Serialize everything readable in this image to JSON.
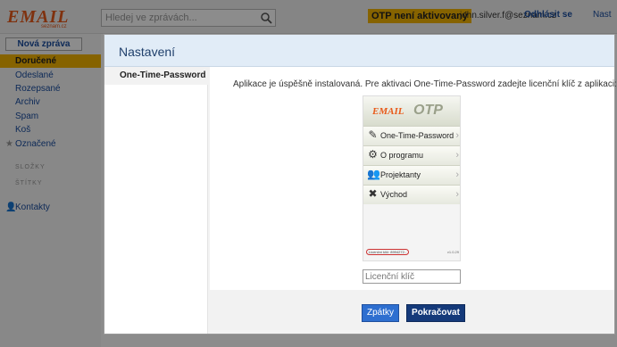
{
  "app": {
    "logo_text": "EMAIL",
    "logo_subtext": "seznam.cz",
    "search": {
      "placeholder": "Hledej ve zprávách...",
      "icon": "search-icon"
    },
    "otp_badge": "OTP není aktivovaný",
    "user_email": "john.silver.f@seznam.cz",
    "logout_label": "Odhlásit se",
    "settings_label": "Nast",
    "accent_color": "#f5b400",
    "link_color": "#1a4ea0"
  },
  "sidebar": {
    "compose_label": "Nová zpráva",
    "folders": [
      {
        "label": "Doručené",
        "active": true
      },
      {
        "label": "Odeslané",
        "active": false
      },
      {
        "label": "Rozepsané",
        "active": false
      },
      {
        "label": "Archiv",
        "active": false
      },
      {
        "label": "Spam",
        "active": false
      },
      {
        "label": "Koš",
        "active": false
      },
      {
        "label": "Označené",
        "active": false,
        "icon": "star-icon"
      }
    ],
    "sections": [
      "SLOŽKY",
      "ŠTÍTKY"
    ],
    "contacts_label": "Kontakty"
  },
  "dialog": {
    "title": "Nastavení",
    "nav": [
      {
        "label": "One-Time-Password",
        "active": true
      }
    ],
    "instruction": "Aplikace je úspěšně instalovaná. Pre aktivaci One-Time-Password zadejte licenční klíč z aplikaci:",
    "phone": {
      "logo_text": "EMAIL",
      "title": "OTP",
      "menu": [
        {
          "label": "One-Time-Password",
          "icon": "pencil-icon"
        },
        {
          "label": "O programu",
          "icon": "gear-icon"
        },
        {
          "label": "Projektanty",
          "icon": "people-icon"
        },
        {
          "label": "Východ",
          "icon": "close-icon"
        }
      ],
      "license_text": "Licenční klíč: 8994272..",
      "version": "v1.0.29"
    },
    "license_input": {
      "placeholder": "Licenční klíč",
      "value": ""
    },
    "buttons": {
      "back": "Zpátky",
      "continue": "Pokračovat"
    }
  }
}
